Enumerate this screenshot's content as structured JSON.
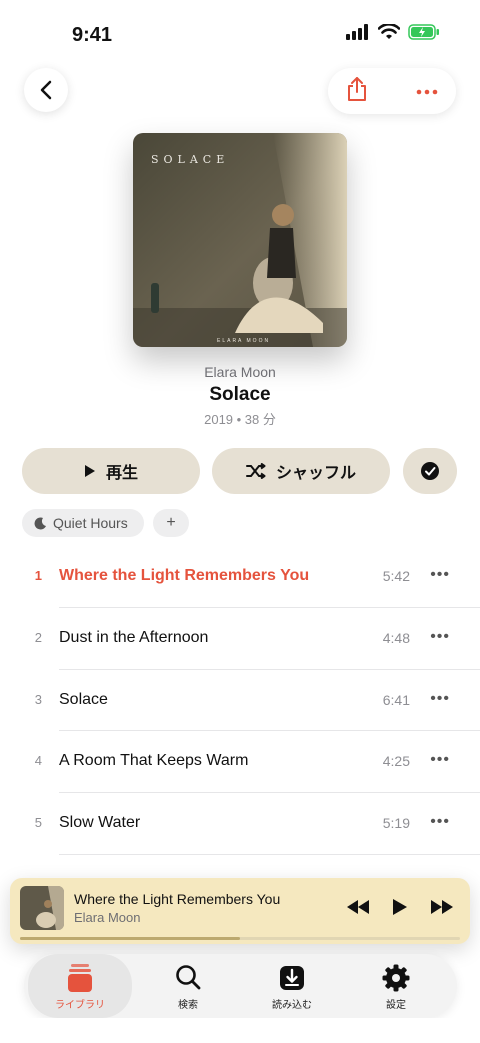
{
  "status_bar": {
    "time": "9:41"
  },
  "album": {
    "artist": "Elara Moon",
    "title": "Solace",
    "meta": "2019 • 38 分",
    "cover_title": "SOLACE",
    "cover_artist": "ELARA MOON"
  },
  "actions": {
    "play_label": "再生",
    "shuffle_label": "シャッフル"
  },
  "chips": {
    "quiet_hours": "Quiet Hours",
    "add": "+"
  },
  "tracks": [
    {
      "num": "1",
      "title": "Where the Light Remembers You",
      "duration": "5:42",
      "more": "•••"
    },
    {
      "num": "2",
      "title": "Dust in the Afternoon",
      "duration": "4:48",
      "more": "•••"
    },
    {
      "num": "3",
      "title": "Solace",
      "duration": "6:41",
      "more": "•••"
    },
    {
      "num": "4",
      "title": "A Room That Keeps Warm",
      "duration": "4:25",
      "more": "•••"
    },
    {
      "num": "5",
      "title": "Slow Water",
      "duration": "5:19",
      "more": "•••"
    }
  ],
  "mini_player": {
    "title": "Where the Light Remembers You",
    "artist": "Elara Moon",
    "progress": 0.5
  },
  "tab_bar": {
    "library": "ライブラリ",
    "search": "検索",
    "downloads": "読み込む",
    "settings": "設定"
  },
  "colors": {
    "accent": "#e5533d",
    "button_bg": "#e6e0d3",
    "mini_player_bg": "#f5e8bf"
  }
}
